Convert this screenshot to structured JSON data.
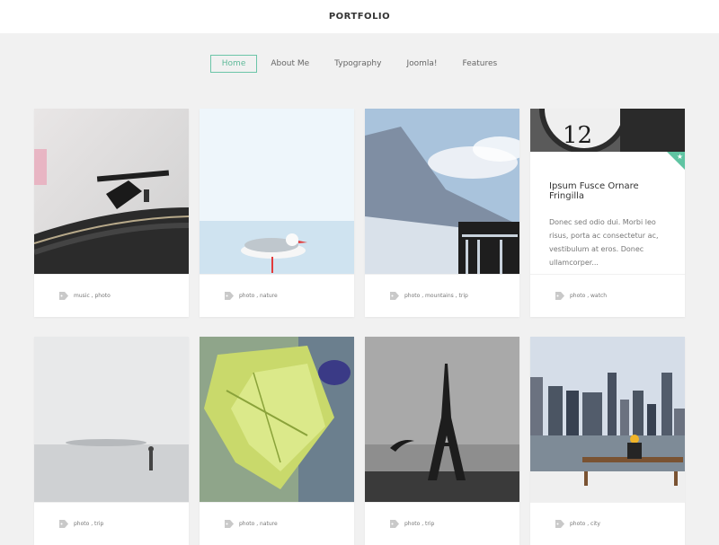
{
  "header": {
    "title": "PORTFOLIO"
  },
  "nav": {
    "items": [
      "Home",
      "About Me",
      "Typography",
      "Joomla!",
      "Features"
    ],
    "active": "Home"
  },
  "cards": [
    {
      "photo": "turntable",
      "tags": "music , photo"
    },
    {
      "photo": "seagull",
      "tags": "photo , nature"
    },
    {
      "photo": "mountains",
      "tags": "photo , mountains , trip"
    },
    {
      "photo": "clock",
      "title": "Ipsum Fusce Ornare Fringilla",
      "excerpt": "Donec sed odio dui. Morbi leo risus, porta ac consectetur ac, vestibulum at eros. Donec ullamcorper...",
      "tags": "photo , watch",
      "corner_icon": "star-icon"
    },
    {
      "photo": "foggy-sea",
      "tags": "photo , trip"
    },
    {
      "photo": "green-leaf",
      "tags": "photo , nature"
    },
    {
      "photo": "eiffel-tower",
      "tags": "photo , trip"
    },
    {
      "photo": "city-skyline",
      "tags": "photo , city"
    }
  ],
  "colors": {
    "accent": "#5fc4a2",
    "background": "#f1f1f1"
  }
}
